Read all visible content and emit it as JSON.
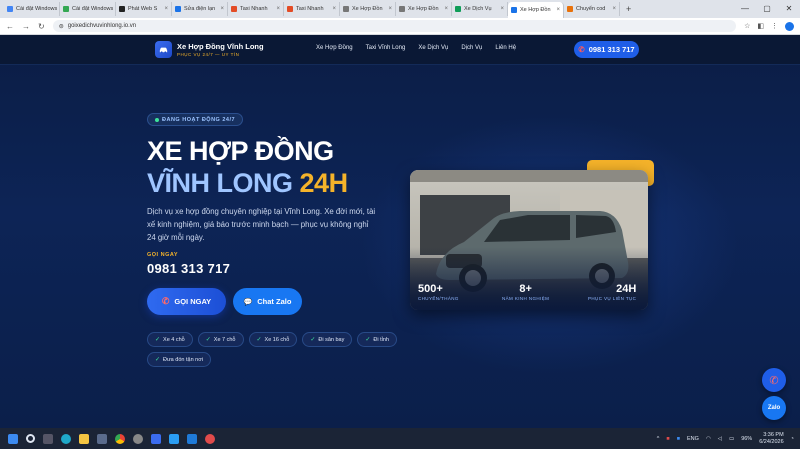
{
  "browser": {
    "tabs": [
      {
        "label": "Cài đặt Windows",
        "color": "#4285f4"
      },
      {
        "label": "Cài đặt Windows",
        "color": "#34a853"
      },
      {
        "label": "Phát Web S",
        "color": "#222222"
      },
      {
        "label": "Sửa điện lạn",
        "color": "#1a73e8"
      },
      {
        "label": "Taxi Nhanh",
        "color": "#e34c26"
      },
      {
        "label": "Taxi Nhanh",
        "color": "#e34c26"
      },
      {
        "label": "Xe Hợp Đồn",
        "color": "#777777"
      },
      {
        "label": "Xe Hợp Đồn",
        "color": "#777777"
      },
      {
        "label": "Xe Dịch Vụ",
        "color": "#0f9d58"
      },
      {
        "label": "Xe Hợp Đồn",
        "color": "#1a73e8",
        "active": true
      },
      {
        "label": "Chuyển cod",
        "color": "#e8710a"
      }
    ],
    "new_tab": "+",
    "url": "goixedichvuvinhlong.io.vn",
    "window_controls": [
      "—",
      "▢",
      "✕"
    ]
  },
  "header": {
    "brand_name": "Xe Hợp Đồng Vĩnh Long",
    "brand_sub": "PHỤC VỤ 24/7 — UY TÍN",
    "nav": [
      "Xe Hợp Đồng",
      "Taxi Vĩnh Long",
      "Xe Dịch Vụ",
      "Dịch Vụ",
      "Liên Hệ"
    ],
    "phone_button": "0981 313 717"
  },
  "hero": {
    "badge": "ĐANG HOẠT ĐỘNG 24/7",
    "title_line1": "XE HỢP ĐỒNG",
    "title_line2_a": "VĨNH LONG",
    "title_line2_b": "24H",
    "description": "Dịch vụ xe hợp đồng chuyên nghiệp tại Vĩnh Long. Xe đời mới, tài xế kinh nghiệm, giá báo trước minh bạch — phục vụ không nghỉ 24 giờ mỗi ngày.",
    "call_label": "GỌI NGAY",
    "phone": "0981 313 717",
    "btn_call": "GỌI NGAY",
    "btn_zalo": "Chat Zalo",
    "chips": [
      "Xe 4 chỗ",
      "Xe 7 chỗ",
      "Xe 16 chỗ",
      "Đi sân bay",
      "Đi tỉnh",
      "Đưa đón tận nơi"
    ]
  },
  "stats": [
    {
      "num": "500+",
      "label": "CHUYẾN/THÁNG"
    },
    {
      "num": "8+",
      "label": "NĂM KINH NGHIỆM"
    },
    {
      "num": "24H",
      "label": "PHỤC VỤ LIÊN TỤC"
    }
  ],
  "floating": {
    "zalo": "Zalo"
  },
  "taskbar": {
    "lang": "ENG",
    "battery": "96%",
    "time": "3:36 PM",
    "date": "6/24/2026"
  },
  "colors": {
    "accent": "#1f5ee8",
    "gold": "#f5b32a",
    "bg": "#0b1d45"
  }
}
